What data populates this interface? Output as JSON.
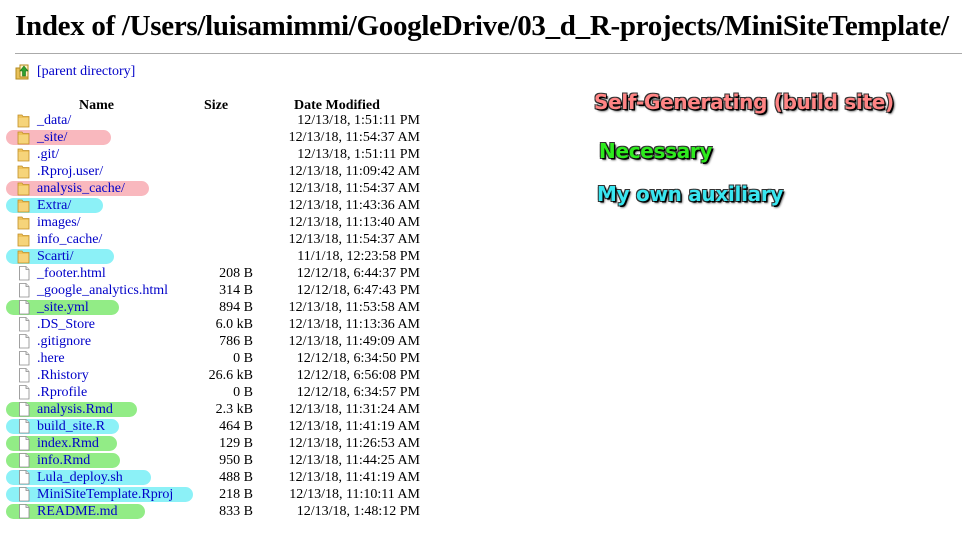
{
  "title": "Index of /Users/luisamimmi/GoogleDrive/03_d_R-projects/MiniSiteTemplate/",
  "parent_link": "[parent directory]",
  "headers": {
    "name": "Name",
    "size": "Size",
    "date": "Date Modified"
  },
  "colors": {
    "link": "#0000c8",
    "red_highlight": "#f9b8be",
    "green_highlight": "#92ec86",
    "cyan_highlight": "#8cf1f7"
  },
  "rows": [
    {
      "name": "_data/",
      "size": "",
      "date": "12/13/18, 1:51:11 PM",
      "type": "folder",
      "highlight": ""
    },
    {
      "name": "_site/",
      "size": "",
      "date": "12/13/18, 11:54:37 AM",
      "type": "folder",
      "highlight": "red"
    },
    {
      "name": ".git/",
      "size": "",
      "date": "12/13/18, 1:51:11 PM",
      "type": "folder",
      "highlight": ""
    },
    {
      "name": ".Rproj.user/",
      "size": "",
      "date": "12/13/18, 11:09:42 AM",
      "type": "folder",
      "highlight": ""
    },
    {
      "name": "analysis_cache/",
      "size": "",
      "date": "12/13/18, 11:54:37 AM",
      "type": "folder",
      "highlight": "red"
    },
    {
      "name": "Extra/",
      "size": "",
      "date": "12/13/18, 11:43:36 AM",
      "type": "folder",
      "highlight": "cyan"
    },
    {
      "name": "images/",
      "size": "",
      "date": "12/13/18, 11:13:40 AM",
      "type": "folder",
      "highlight": ""
    },
    {
      "name": "info_cache/",
      "size": "",
      "date": "12/13/18, 11:54:37 AM",
      "type": "folder",
      "highlight": ""
    },
    {
      "name": "Scarti/",
      "size": "",
      "date": "11/1/18, 12:23:58 PM",
      "type": "folder",
      "highlight": "cyan"
    },
    {
      "name": "_footer.html",
      "size": "208 B",
      "date": "12/12/18, 6:44:37 PM",
      "type": "file",
      "highlight": ""
    },
    {
      "name": "_google_analytics.html",
      "size": "314 B",
      "date": "12/12/18, 6:47:43 PM",
      "type": "file",
      "highlight": ""
    },
    {
      "name": "_site.yml",
      "size": "894 B",
      "date": "12/13/18, 11:53:58 AM",
      "type": "file",
      "highlight": "green"
    },
    {
      "name": ".DS_Store",
      "size": "6.0 kB",
      "date": "12/13/18, 11:13:36 AM",
      "type": "file",
      "highlight": ""
    },
    {
      "name": ".gitignore",
      "size": "786 B",
      "date": "12/13/18, 11:49:09 AM",
      "type": "file",
      "highlight": ""
    },
    {
      "name": ".here",
      "size": "0 B",
      "date": "12/12/18, 6:34:50 PM",
      "type": "file",
      "highlight": ""
    },
    {
      "name": ".Rhistory",
      "size": "26.6 kB",
      "date": "12/12/18, 6:56:08 PM",
      "type": "file",
      "highlight": ""
    },
    {
      "name": ".Rprofile",
      "size": "0 B",
      "date": "12/12/18, 6:34:57 PM",
      "type": "file",
      "highlight": ""
    },
    {
      "name": "analysis.Rmd",
      "size": "2.3 kB",
      "date": "12/13/18, 11:31:24 AM",
      "type": "file",
      "highlight": "green"
    },
    {
      "name": "build_site.R",
      "size": "464 B",
      "date": "12/13/18, 11:41:19 AM",
      "type": "file",
      "highlight": "cyan"
    },
    {
      "name": "index.Rmd",
      "size": "129 B",
      "date": "12/13/18, 11:26:53 AM",
      "type": "file",
      "highlight": "green"
    },
    {
      "name": "info.Rmd",
      "size": "950 B",
      "date": "12/13/18, 11:44:25 AM",
      "type": "file",
      "highlight": "green"
    },
    {
      "name": "Lula_deploy.sh",
      "size": "488 B",
      "date": "12/13/18, 11:41:19 AM",
      "type": "file",
      "highlight": "cyan"
    },
    {
      "name": "MiniSiteTemplate.Rproj",
      "size": "218 B",
      "date": "12/13/18, 11:10:11 AM",
      "type": "file",
      "highlight": "cyan"
    },
    {
      "name": "README.md",
      "size": "833 B",
      "date": "12/13/18, 1:48:12 PM",
      "type": "file",
      "highlight": "green"
    }
  ],
  "legend": [
    {
      "label": "Self-Generating (build site)",
      "color": "#ff8484"
    },
    {
      "label": "Necessary",
      "color": "#2eea1e"
    },
    {
      "label": "My own auxiliary",
      "color": "#39e6f0"
    }
  ]
}
